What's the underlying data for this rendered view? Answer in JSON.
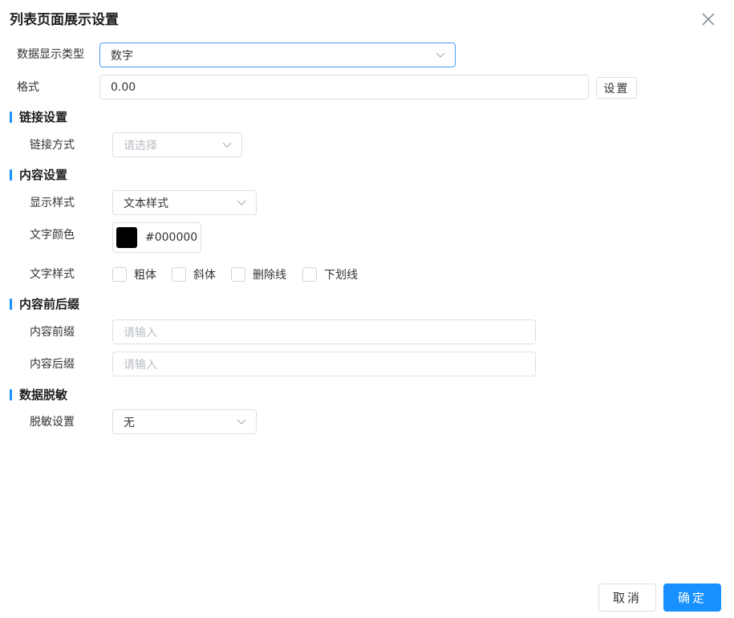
{
  "dialog": {
    "title": "列表页面展示设置",
    "close_icon": "close-icon"
  },
  "data_type": {
    "label": "数据显示类型",
    "value": "数字"
  },
  "format": {
    "label": "格式",
    "value": "0.00",
    "button_label": "设置"
  },
  "link_section": {
    "title": "链接设置",
    "method_label": "链接方式",
    "method_placeholder": "请选择"
  },
  "content_section": {
    "title": "内容设置",
    "display_style_label": "显示样式",
    "display_style_value": "文本样式",
    "text_color_label": "文字颜色",
    "text_color_value": "#000000",
    "text_style_label": "文字样式",
    "text_style_options": [
      "粗体",
      "斜体",
      "删除线",
      "下划线"
    ]
  },
  "affix_section": {
    "title": "内容前后缀",
    "prefix_label": "内容前缀",
    "prefix_placeholder": "请输入",
    "suffix_label": "内容后缀",
    "suffix_placeholder": "请输入"
  },
  "mask_section": {
    "title": "数据脱敏",
    "mask_label": "脱敏设置",
    "mask_value": "无"
  },
  "footer": {
    "cancel_label": "取消",
    "ok_label": "确定"
  },
  "colors": {
    "accent": "#1890ff",
    "border": "#dcdfe6",
    "swatch": "#000000"
  }
}
